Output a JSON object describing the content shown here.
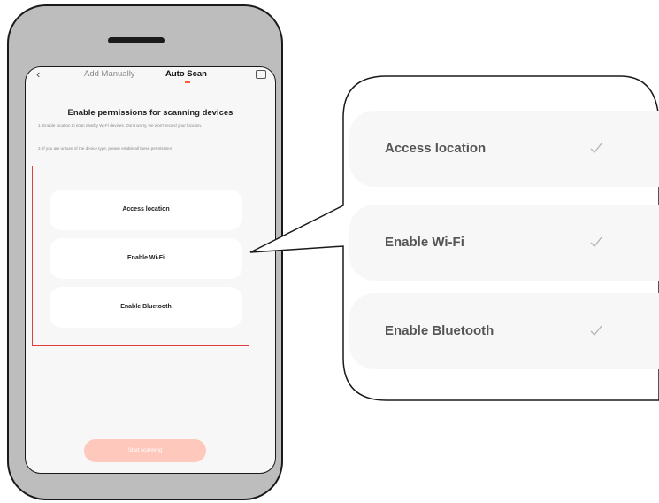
{
  "phone": {
    "tabs": {
      "manual": "Add Manually",
      "auto": "Auto Scan"
    },
    "heading": "Enable permissions for scanning devices",
    "desc1": "1. Enable location to scan nearby Wi-Fi devices. Don't worry, we won't record your location.",
    "desc2": "2. If you are unsure of the device type, please enable all these permissions",
    "permissions": [
      "Access location",
      "Enable Wi-Fi",
      "Enable Bluetooth"
    ],
    "start_button": "Start scanning"
  },
  "popup": {
    "items": [
      "Access location",
      "Enable Wi-Fi",
      "Enable Bluetooth"
    ]
  },
  "colors": {
    "accent": "#ff5a3c",
    "highlight_border": "#e23b3b",
    "start_button_bg": "#ffc8bd"
  },
  "icons": [
    "back-arrow-icon",
    "scan-icon",
    "check-icon"
  ]
}
